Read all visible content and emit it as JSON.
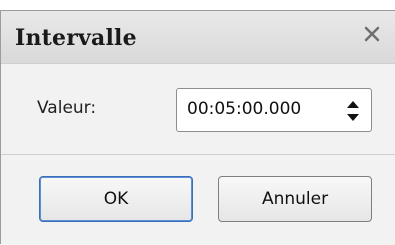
{
  "dialog": {
    "title": "Intervalle",
    "close_icon": "close-icon"
  },
  "field": {
    "label": "Valeur:",
    "value": "00:05:00.000",
    "spinner_icon": "spinner-up-down-icon"
  },
  "buttons": {
    "ok": "OK",
    "cancel": "Annuler"
  },
  "colors": {
    "background": "#f2f2f2",
    "titlebar": "#e1e1e1",
    "button_border": "#7f7f7f",
    "default_button_accent": "#3a6fb8"
  }
}
